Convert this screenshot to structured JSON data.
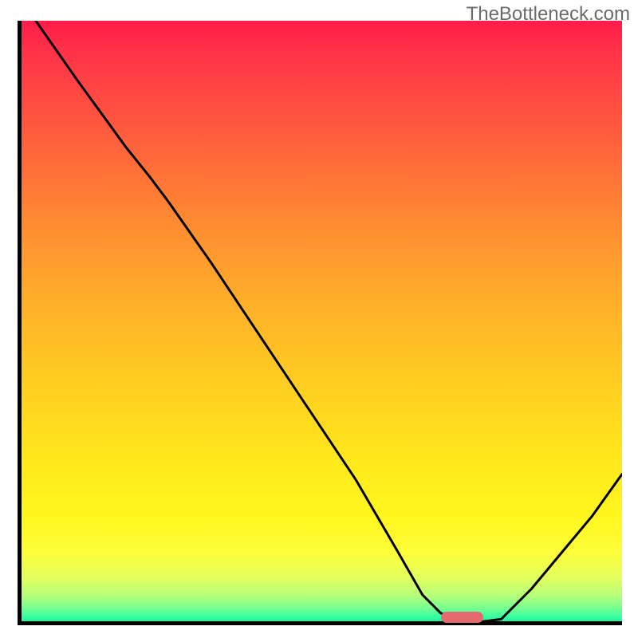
{
  "watermark": "TheBottleneck.com",
  "chart_data": {
    "type": "line",
    "title": "",
    "xlabel": "",
    "ylabel": "",
    "xlim": [
      0,
      100
    ],
    "ylim": [
      0,
      100
    ],
    "background_gradient": {
      "direction": "vertical",
      "stops": [
        {
          "pos": 0.0,
          "color": "#ff1c4a"
        },
        {
          "pos": 0.33,
          "color": "#ff8a32"
        },
        {
          "pos": 0.62,
          "color": "#ffd220"
        },
        {
          "pos": 0.88,
          "color": "#fdfe3a"
        },
        {
          "pos": 1.0,
          "color": "#00f0a0"
        }
      ]
    },
    "series": [
      {
        "name": "bottleneck-curve",
        "x": [
          3,
          10,
          18,
          22,
          25,
          32,
          40,
          48,
          56,
          63,
          67,
          70,
          73,
          76,
          80,
          85,
          90,
          95,
          100
        ],
        "y": [
          100,
          90,
          79,
          74,
          70,
          60,
          48,
          36,
          24,
          12,
          5,
          2,
          1,
          0.5,
          1,
          6,
          12,
          18,
          25
        ]
      }
    ],
    "marker": {
      "name": "optimal-point",
      "x_range": [
        70,
        77
      ],
      "y": 0.5,
      "color": "#e46a6f"
    }
  }
}
